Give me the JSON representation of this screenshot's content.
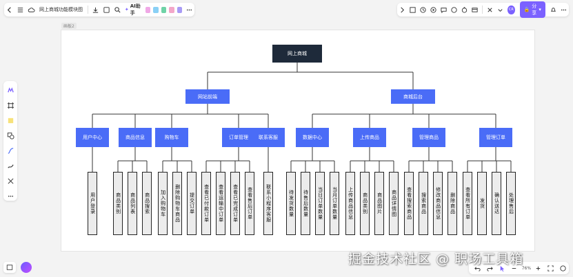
{
  "toolbar": {
    "doc_title": "网上商城功能模块图",
    "ai_label": "AI助手",
    "share_label": "分享",
    "avatar_text": "CR"
  },
  "canvas": {
    "frame_label": "画板2"
  },
  "diagram": {
    "root": "网上商城",
    "branches": [
      {
        "label": "网站前端",
        "children": [
          {
            "label": "用户中心",
            "leaves": [
              "用户登录"
            ]
          },
          {
            "label": "商品信息",
            "leaves": [
              "商品类别",
              "商品列表",
              "商品搜索"
            ]
          },
          {
            "label": "购物车",
            "leaves": [
              "加入购物车",
              "删除购物车商品",
              "提交订单"
            ]
          },
          {
            "label": "订单管理",
            "leaves": [
              "查看已付款订单",
              "查看运输中订单",
              "查看已完成订单",
              "查看售后订单"
            ]
          },
          {
            "label": "联系客服",
            "leaves": [
              "联系小程序客服"
            ]
          }
        ]
      },
      {
        "label": "商城后台",
        "children": [
          {
            "label": "数据中心",
            "leaves": [
              "待发货数量",
              "待售后数量",
              "当日订单数量",
              "当月订单数量"
            ]
          },
          {
            "label": "上传商品",
            "leaves": [
              "上传商品信息",
              "商品类别",
              "商品图片",
              "商品详情图"
            ]
          },
          {
            "label": "管理商品",
            "leaves": [
              "查看搜索商品",
              "搜索商品",
              "修改商品信息",
              "删除商品"
            ]
          },
          {
            "label": "管理订单",
            "leaves": [
              "查看所有订单",
              "发货",
              "确认送达",
              "处理售后"
            ]
          }
        ]
      }
    ]
  },
  "zoom": {
    "value": "76%"
  },
  "watermark": "掘金技术社区 @ 职场工具箱",
  "colors": {
    "root": "#1e2a3a",
    "node": "#4a6cf7",
    "leaf_bg": "#ececec",
    "accent": "#7b61ff"
  }
}
